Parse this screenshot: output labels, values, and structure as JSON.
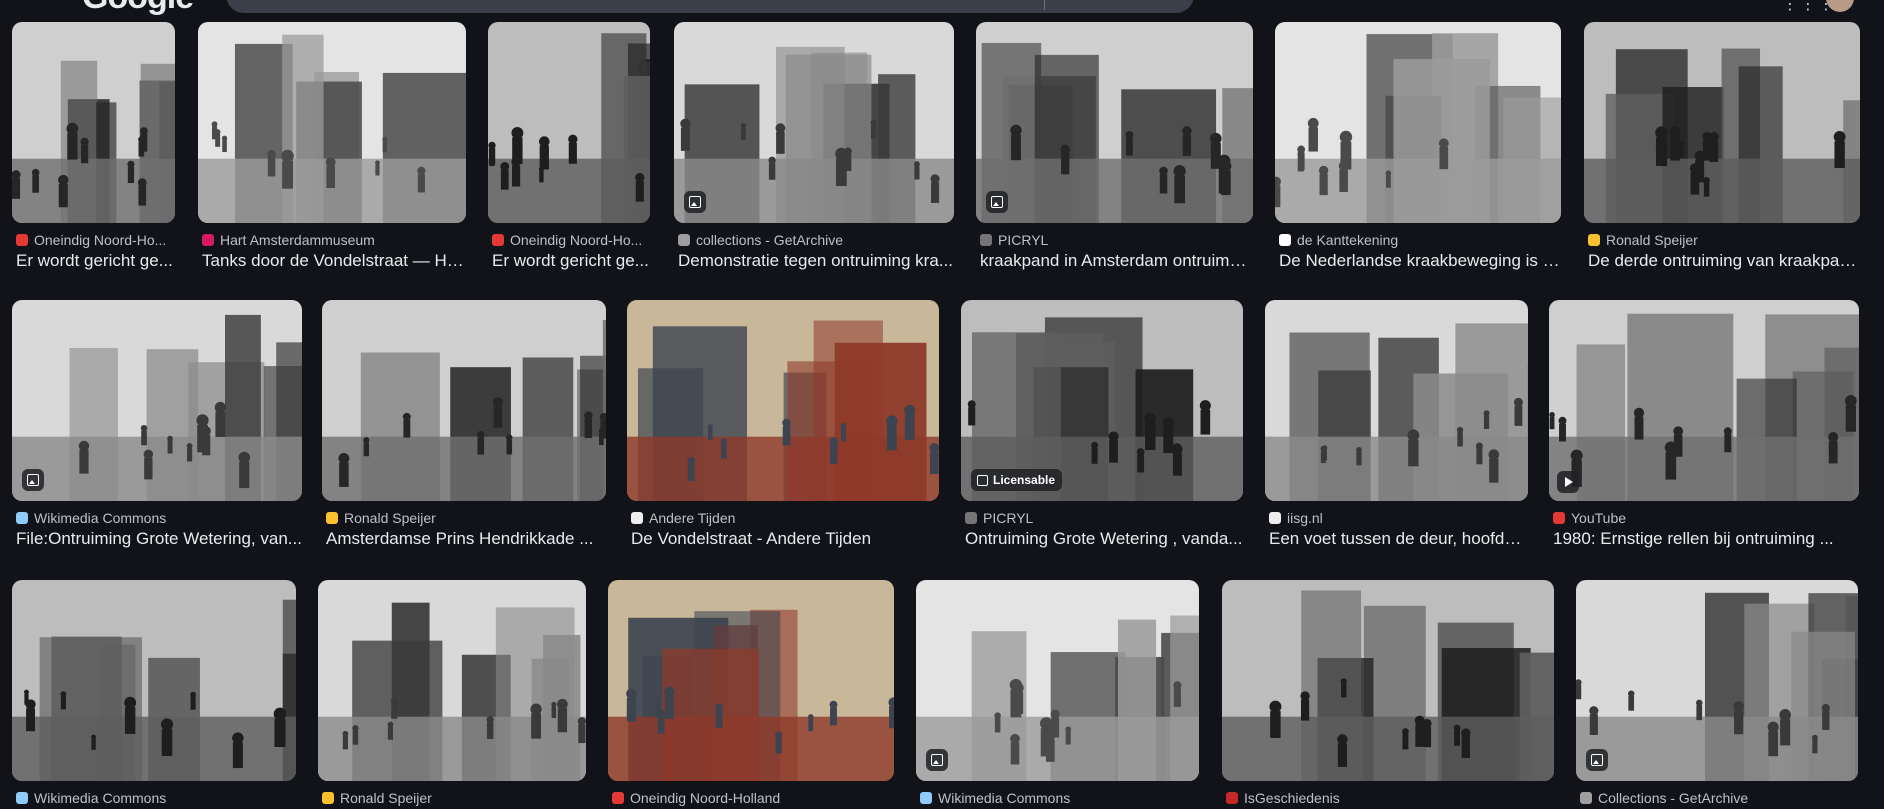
{
  "header": {
    "logo_text": "Google",
    "apps_icon": "grid-apps-icon",
    "avatar": "user-avatar"
  },
  "colors": {
    "background": "#111318",
    "title_text": "#e8eaed",
    "source_text": "#bdc1c6"
  },
  "rows": [
    {
      "cards": [
        {
          "source": "Oneindig Noord-Ho...",
          "title": "Er wordt gericht ge...",
          "favicon_color": "#e53935",
          "badge": ""
        },
        {
          "source": "Hart Amsterdammuseum",
          "title": "Tanks door de Vondelstraat — Ha...",
          "favicon_color": "#d81b60",
          "badge": ""
        },
        {
          "source": "Oneindig Noord-Ho...",
          "title": "Er wordt gericht ge...",
          "favicon_color": "#e53935",
          "badge": ""
        },
        {
          "source": "collections - GetArchive",
          "title": "Demonstratie tegen ontruiming kra...",
          "favicon_color": "#9e9e9e",
          "badge": "image"
        },
        {
          "source": "PICRYL",
          "title": "kraakpand in Amsterdam ontruimd ...",
          "favicon_color": "#757575",
          "badge": "image"
        },
        {
          "source": "de Kanttekening",
          "title": "De Nederlandse kraakbeweging is n...",
          "favicon_color": "#ffffff",
          "badge": ""
        },
        {
          "source": "Ronald Speijer",
          "title": "De derde ontruiming van kraakpan...",
          "favicon_color": "#fbc02d",
          "badge": ""
        }
      ]
    },
    {
      "cards": [
        {
          "source": "Wikimedia Commons",
          "title": "File:Ontruiming Grote Wetering, van...",
          "favicon_color": "#90caf9",
          "badge": "image"
        },
        {
          "source": "Ronald Speijer",
          "title": "Amsterdamse Prins Hendrikkade ...",
          "favicon_color": "#fbc02d",
          "badge": ""
        },
        {
          "source": "Andere Tijden",
          "title": "De Vondelstraat - Andere Tijden",
          "favicon_color": "#eeeeee",
          "badge": ""
        },
        {
          "source": "PICRYL",
          "title": "Ontruiming Grote Wetering , vanda...",
          "favicon_color": "#757575",
          "badge": "licensable",
          "badge_label": "Licensable"
        },
        {
          "source": "iisg.nl",
          "title": "Een voet tussen de deur, hoofdst...",
          "favicon_color": "#eeeeee",
          "badge": ""
        },
        {
          "source": "YouTube",
          "title": "1980: Ernstige rellen bij ontruiming ...",
          "favicon_color": "#e53935",
          "badge": "video"
        }
      ]
    },
    {
      "cards": [
        {
          "source": "Wikimedia Commons",
          "title": "",
          "favicon_color": "#90caf9",
          "badge": ""
        },
        {
          "source": "Ronald Speijer",
          "title": "",
          "favicon_color": "#fbc02d",
          "badge": ""
        },
        {
          "source": "Oneindig Noord-Holland",
          "title": "",
          "favicon_color": "#e53935",
          "badge": ""
        },
        {
          "source": "Wikimedia Commons",
          "title": "",
          "favicon_color": "#90caf9",
          "badge": "image"
        },
        {
          "source": "IsGeschiedenis",
          "title": "",
          "favicon_color": "#c62828",
          "badge": ""
        },
        {
          "source": "Collections - GetArchive",
          "title": "",
          "favicon_color": "#9e9e9e",
          "badge": "image"
        }
      ]
    }
  ]
}
